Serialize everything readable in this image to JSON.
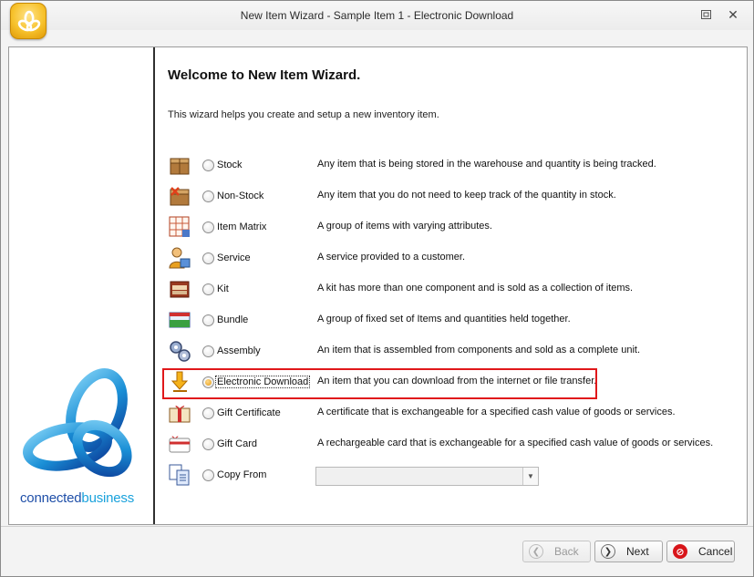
{
  "window": {
    "title": "New Item Wizard - Sample Item 1 - Electronic Download",
    "restore_icon": "restore-window-icon",
    "close_glyph": "✕"
  },
  "sidebar": {
    "brand_part1": "connected",
    "brand_part2": "business"
  },
  "wizard": {
    "heading": "Welcome to New Item Wizard.",
    "intro": "This wizard helps you create and setup a new inventory item.",
    "options": [
      {
        "label": "Stock",
        "description": "Any item that is being stored in the warehouse and quantity is being tracked.",
        "icon": "stock-box-icon",
        "selected": false
      },
      {
        "label": "Non-Stock",
        "description": "Any item that you do not need to keep track of the quantity in stock.",
        "icon": "non-stock-box-icon",
        "selected": false
      },
      {
        "label": "Item Matrix",
        "description": "A group of items with varying attributes.",
        "icon": "grid-matrix-icon",
        "selected": false
      },
      {
        "label": "Service",
        "description": "A service provided to a customer.",
        "icon": "service-person-icon",
        "selected": false
      },
      {
        "label": "Kit",
        "description": "A kit has more than one component and is sold as a collection of items.",
        "icon": "kit-case-icon",
        "selected": false
      },
      {
        "label": "Bundle",
        "description": "A group of fixed set of Items and quantities held together.",
        "icon": "bundle-icon",
        "selected": false
      },
      {
        "label": "Assembly",
        "description": "An item that is assembled from components and sold as a complete unit.",
        "icon": "assembly-gears-icon",
        "selected": false
      },
      {
        "label": "Electronic Download",
        "description": "An item that you can download from the internet or file transfer.",
        "icon": "download-arrow-icon",
        "selected": true
      },
      {
        "label": "Gift Certificate",
        "description": "A certificate that is exchangeable for a specified cash value of goods or services.",
        "icon": "gift-certificate-icon",
        "selected": false
      },
      {
        "label": "Gift Card",
        "description": "A rechargeable card that is exchangeable for a specified cash value of goods or services.",
        "icon": "gift-card-icon",
        "selected": false
      },
      {
        "label": "Copy From",
        "description": "",
        "icon": "copy-documents-icon",
        "selected": false
      }
    ],
    "copy_from_value": ""
  },
  "buttons": {
    "back": "Back",
    "next": "Next",
    "cancel": "Cancel"
  },
  "colors": {
    "highlight": "#e0181b",
    "brand_blue": "#1f4fa8",
    "brand_cyan": "#1aa2dc"
  }
}
